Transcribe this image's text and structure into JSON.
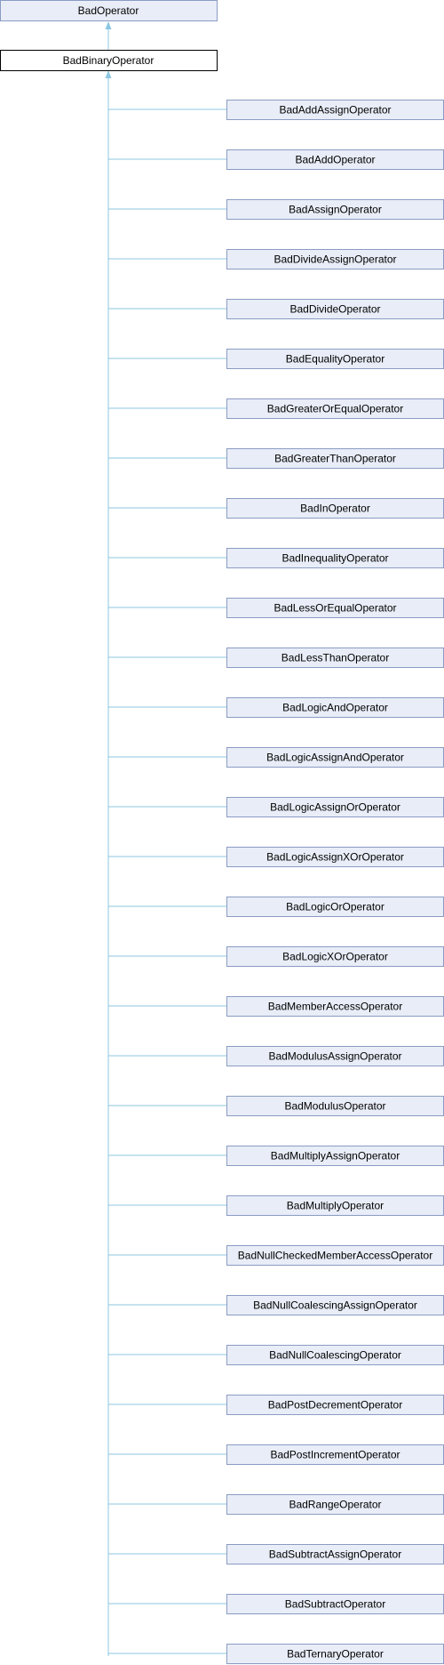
{
  "diagram": {
    "root": {
      "label": "BadOperator",
      "fill": "#e8edf7",
      "stroke": "#8b9bc4"
    },
    "parent": {
      "label": "BadBinaryOperator",
      "fill": "#ffffff",
      "stroke": "#000000"
    },
    "edge_color": "#8cc7e2",
    "child_fill": "#e8edf7",
    "child_stroke": "#8b9bc4",
    "children": [
      "BadAddAssignOperator",
      "BadAddOperator",
      "BadAssignOperator",
      "BadDivideAssignOperator",
      "BadDivideOperator",
      "BadEqualityOperator",
      "BadGreaterOrEqualOperator",
      "BadGreaterThanOperator",
      "BadInOperator",
      "BadInequalityOperator",
      "BadLessOrEqualOperator",
      "BadLessThanOperator",
      "BadLogicAndOperator",
      "BadLogicAssignAndOperator",
      "BadLogicAssignOrOperator",
      "BadLogicAssignXOrOperator",
      "BadLogicOrOperator",
      "BadLogicXOrOperator",
      "BadMemberAccessOperator",
      "BadModulusAssignOperator",
      "BadModulusOperator",
      "BadMultiplyAssignOperator",
      "BadMultiplyOperator",
      "BadNullCheckedMemberAccessOperator",
      "BadNullCoalescingAssignOperator",
      "BadNullCoalescingOperator",
      "BadPostDecrementOperator",
      "BadPostIncrementOperator",
      "BadRangeOperator",
      "BadSubtractAssignOperator",
      "BadSubtractOperator",
      "BadTernaryOperator"
    ]
  }
}
